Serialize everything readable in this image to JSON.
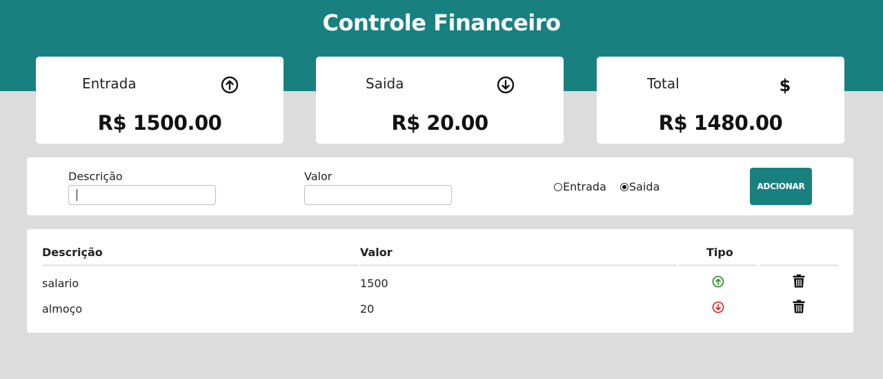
{
  "header": {
    "title": "Controle Financeiro",
    "color": "#198080"
  },
  "cards": {
    "income": {
      "label": "Entrada",
      "value": "R$ 1500.00",
      "icon": "arrow-up-circle-icon"
    },
    "expense": {
      "label": "Saida",
      "value": "R$ 20.00",
      "icon": "arrow-down-circle-icon"
    },
    "total": {
      "label": "Total",
      "value": "R$ 1480.00",
      "icon": "dollar-icon"
    }
  },
  "form": {
    "description_label": "Descrição",
    "description_value": "",
    "value_label": "Valor",
    "value_value": "",
    "radio_income_label": "Entrada",
    "radio_expense_label": "Saida",
    "selected_type": "Saida",
    "add_button_label": "ADCIONAR"
  },
  "table": {
    "columns": [
      "Descrição",
      "Valor",
      "Tipo"
    ],
    "rows": [
      {
        "description": "salario",
        "value": "1500",
        "type": "income",
        "type_color": "#1a8a1a"
      },
      {
        "description": "almoço",
        "value": "20",
        "type": "expense",
        "type_color": "#e01b1b"
      }
    ]
  }
}
